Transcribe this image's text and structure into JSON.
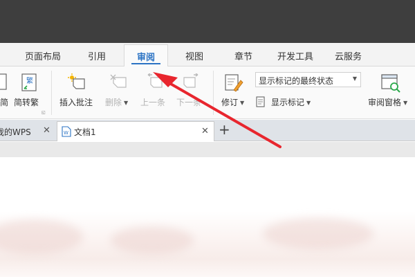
{
  "menu": {
    "tabs": [
      {
        "label": "页面布局"
      },
      {
        "label": "引用"
      },
      {
        "label": "审阅",
        "active": true
      },
      {
        "label": "视图"
      },
      {
        "label": "章节"
      },
      {
        "label": "开发工具"
      },
      {
        "label": "云服务"
      }
    ]
  },
  "ribbon": {
    "simp_trad_partial": "简",
    "simp_to_trad": "简转繁",
    "insert_comment": "插入批注",
    "delete": "删除",
    "previous": "上一条",
    "next": "下一条",
    "revise": "修订",
    "show_markup_state": "显示标记的最终状态",
    "show_markup": "显示标记",
    "review_pane": "审阅窗格"
  },
  "doc_tabs": [
    {
      "label": "我的WPS",
      "active": false
    },
    {
      "label": "文档1",
      "active": true
    }
  ],
  "icons": {
    "close": "close-icon",
    "new_tab": "plus-icon",
    "document": "document-icon",
    "dropdown": "caret-down-icon"
  },
  "colors": {
    "active_tab": "#2b73c4",
    "annotation_arrow": "#e8262e",
    "title_bar": "#3e3e3e"
  }
}
